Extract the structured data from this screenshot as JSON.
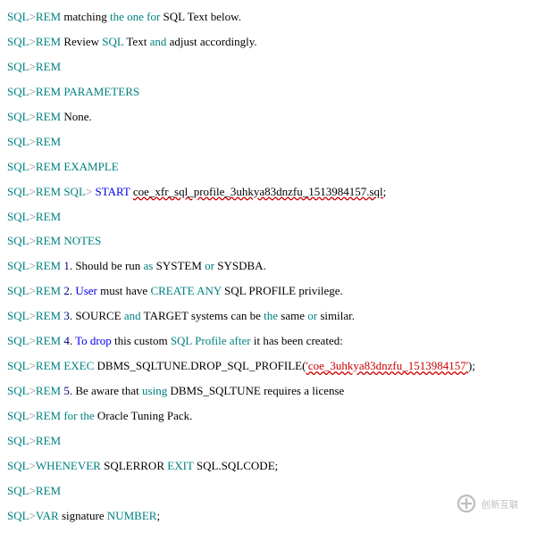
{
  "lines": {
    "l1": {
      "p": "SQL",
      "r": "REM",
      "pad": "    matching ",
      "a": "the one for",
      "b": " SQL Text below."
    },
    "l2": {
      "p": "SQL",
      "r": "REM",
      "pad": "    Review ",
      "a": "SQL",
      "b": " Text ",
      "c": "and",
      "d": " adjust accordingly."
    },
    "l3": {
      "p": "SQL",
      "r": "REM"
    },
    "l4": {
      "p": "SQL",
      "r": "REM",
      "a": " PARAMETERS"
    },
    "l5": {
      "p": "SQL",
      "r": "REM",
      "pad": "    ",
      "a": "None."
    },
    "l6": {
      "p": "SQL",
      "r": "REM"
    },
    "l7": {
      "p": "SQL",
      "r": "REM",
      "a": " EXAMPLE"
    },
    "l8": {
      "p": "SQL",
      "r": "REM",
      "pad": "    ",
      "a": "SQL",
      "gt": ">",
      "sp": " ",
      "b": "START",
      "c": " ",
      "d": "coe_xfr_sql_profile_3uhkya83dnzfu_1513984157.sql",
      "e": ";"
    },
    "l9": {
      "p": "SQL",
      "r": "REM"
    },
    "l10": {
      "p": "SQL",
      "r": "REM",
      "a": " NOTES"
    },
    "l11": {
      "p": "SQL",
      "r": "REM",
      "pad": "    ",
      "n": "1",
      "a": ". Should be run ",
      "b": "as",
      "c": " SYSTEM ",
      "d": "or",
      "e": " SYSDBA."
    },
    "l12": {
      "p": "SQL",
      "r": "REM",
      "pad": "    ",
      "n": "2",
      "a": ". ",
      "b": "User",
      "c": " must have ",
      "d": "CREATE ANY",
      "e": " SQL PROFILE privilege."
    },
    "l13": {
      "p": "SQL",
      "r": "REM",
      "pad": "    ",
      "n": "3",
      "a": ". SOURCE ",
      "b": "and",
      "c": " TARGET systems can be ",
      "d": "the",
      "e": " same ",
      "f": "or",
      "g": " similar."
    },
    "l14": {
      "p": "SQL",
      "r": "REM",
      "pad": "    ",
      "n": "4",
      "a": ". ",
      "b": "To drop",
      "c": " this custom ",
      "d": "SQL Profile after",
      "e": " it has been created:"
    },
    "l15": {
      "p": "SQL",
      "r": "REM",
      "pad": "    ",
      "a": "EXEC",
      "b": " DBMS_SQLTUNE.DROP_SQL_PROFILE(",
      "c": "'coe_3uhkya83dnzfu_1513984157'",
      "d": ");"
    },
    "l16": {
      "p": "SQL",
      "r": "REM",
      "pad": "    ",
      "n": "5",
      "a": ". Be aware that ",
      "b": "using",
      "c": " DBMS_SQLTUNE requires a license"
    },
    "l17": {
      "p": "SQL",
      "r": "REM",
      "pad": "    ",
      "a": "for the",
      "b": " Oracle Tuning Pack."
    },
    "l18": {
      "p": "SQL",
      "r": "REM"
    },
    "l19": {
      "p": "SQL",
      "a": "WHENEVER",
      "b": " SQLERROR ",
      "c": "EXIT",
      "d": " SQL.SQLCODE;"
    },
    "l20": {
      "p": "SQL",
      "r": "REM"
    },
    "l21": {
      "p": "SQL",
      "a": "VAR",
      "b": " signature ",
      "c": "NUMBER",
      "d": ";"
    }
  },
  "logo_text": "创新互联"
}
